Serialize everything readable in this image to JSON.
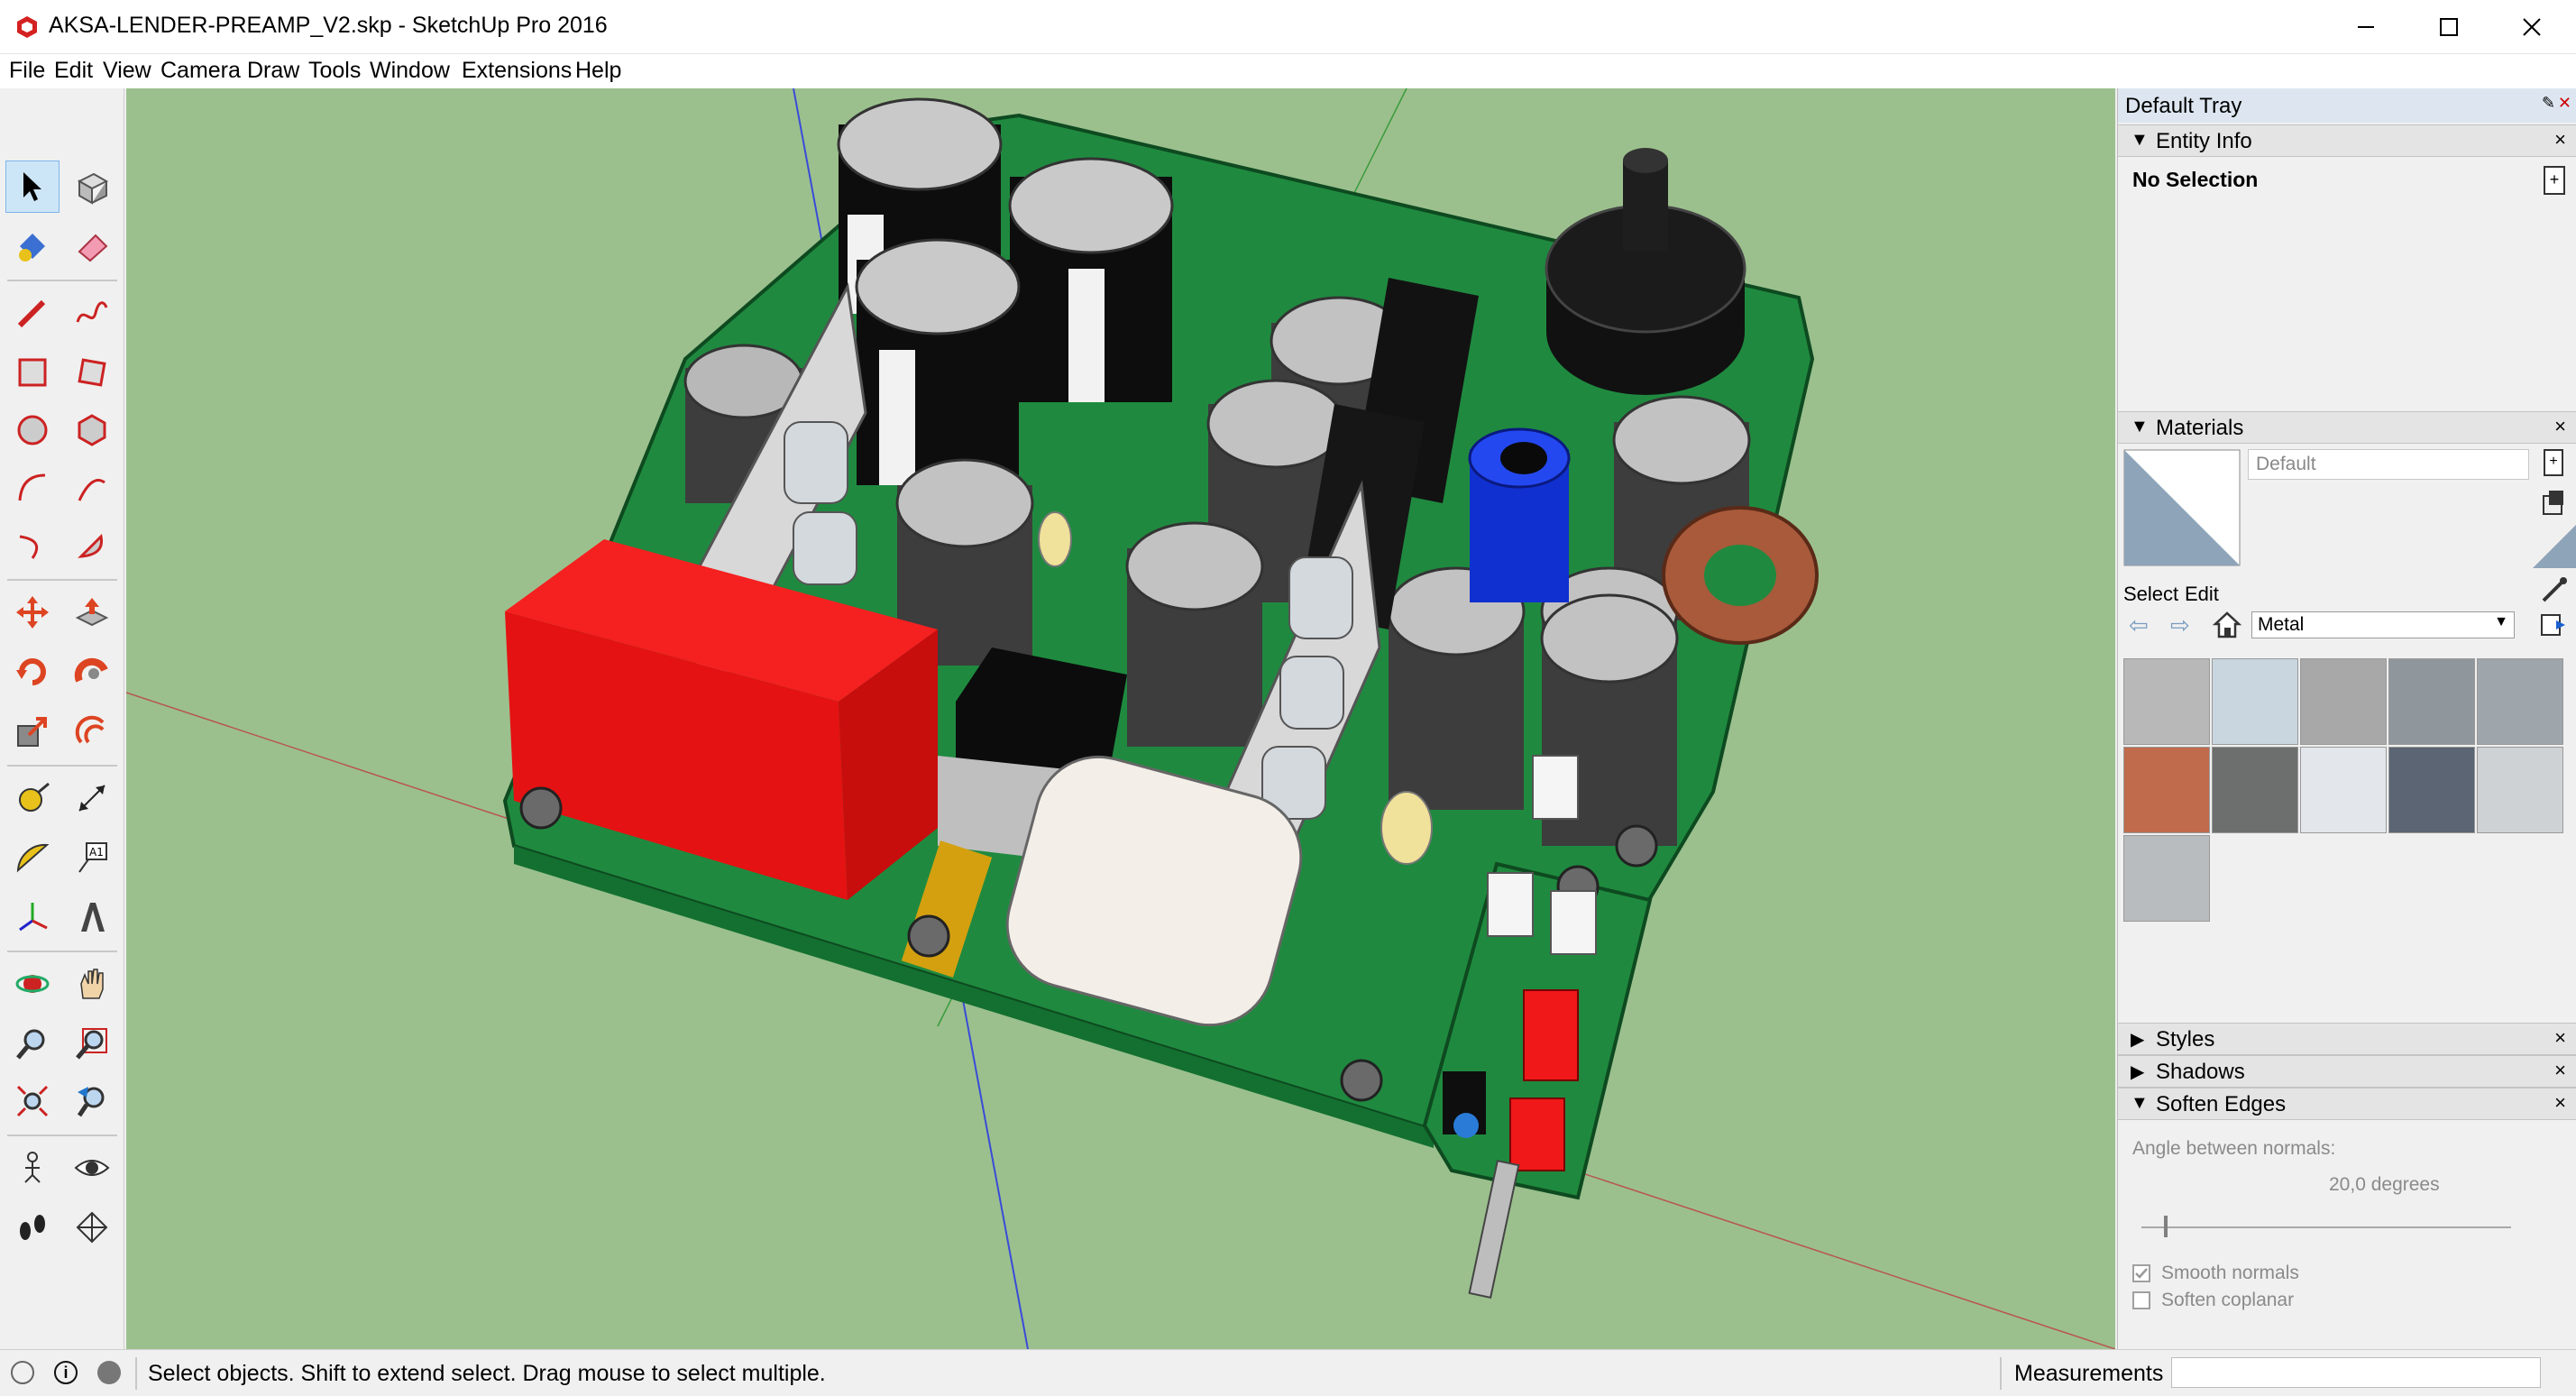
{
  "window": {
    "title": "AKSA-LENDER-PREAMP_V2.skp - SketchUp Pro 2016",
    "controls": [
      "minimize-icon",
      "maximize-icon",
      "close-icon"
    ]
  },
  "menu": [
    "File",
    "Edit",
    "View",
    "Camera",
    "Draw",
    "Tools",
    "Window",
    "Extensions",
    "Help"
  ],
  "toolbar": {
    "tools": [
      "select-icon",
      "make-component-icon",
      "paint-bucket-icon",
      "eraser-icon",
      "pencil-icon",
      "freehand-icon",
      "rectangle-icon",
      "rotated-rectangle-icon",
      "circle-icon",
      "polygon-icon",
      "arc-icon",
      "two-point-arc-icon",
      "three-point-arc-icon",
      "pie-icon",
      "move-icon",
      "push-pull-icon",
      "rotate-icon",
      "follow-me-icon",
      "scale-icon",
      "offset-icon",
      "tape-measure-icon",
      "dimension-icon",
      "protractor-icon",
      "text-icon",
      "axes-icon",
      "3d-text-icon",
      "orbit-icon",
      "pan-icon",
      "zoom-icon",
      "zoom-window-icon",
      "zoom-extents-icon",
      "previous-view-icon",
      "position-camera-icon",
      "look-around-icon",
      "walk-icon",
      "section-plane-icon"
    ],
    "active": "select-icon"
  },
  "tray": {
    "title": "Default Tray",
    "entity_info": {
      "label": "Entity Info",
      "selection": "No Selection"
    },
    "materials": {
      "label": "Materials",
      "current_name": "Default",
      "tabs": [
        "Select",
        "Edit"
      ],
      "library": "Metal",
      "swatch_colors": [
        "#b8b8b8",
        "#c9d6e0",
        "#a8a8a8",
        "#8f979c",
        "#9ea6ab",
        "#c06b4c",
        "#6c6f6e",
        "#e3e6ea",
        "#5b6573",
        "#cfd2d4",
        "#b9bcbe"
      ]
    },
    "styles": {
      "label": "Styles"
    },
    "shadows": {
      "label": "Shadows"
    },
    "soften_edges": {
      "label": "Soften Edges",
      "angle_label": "Angle between normals:",
      "angle_value": "20,0  degrees",
      "angle_fraction": 0.2,
      "smooth_normals": "Smooth normals",
      "smooth_normals_checked": true,
      "soften_coplanar": "Soften coplanar",
      "soften_coplanar_checked": false
    }
  },
  "status": {
    "hint": "Select objects. Shift to extend select. Drag mouse to select multiple.",
    "measurements_label": "Measurements",
    "measurements_value": ""
  },
  "colors": {
    "viewport_ground": "#9bc08d",
    "pcb_green": "#1f8a3f",
    "relay_red": "#e41212",
    "tray_header": "#dde6f0"
  }
}
